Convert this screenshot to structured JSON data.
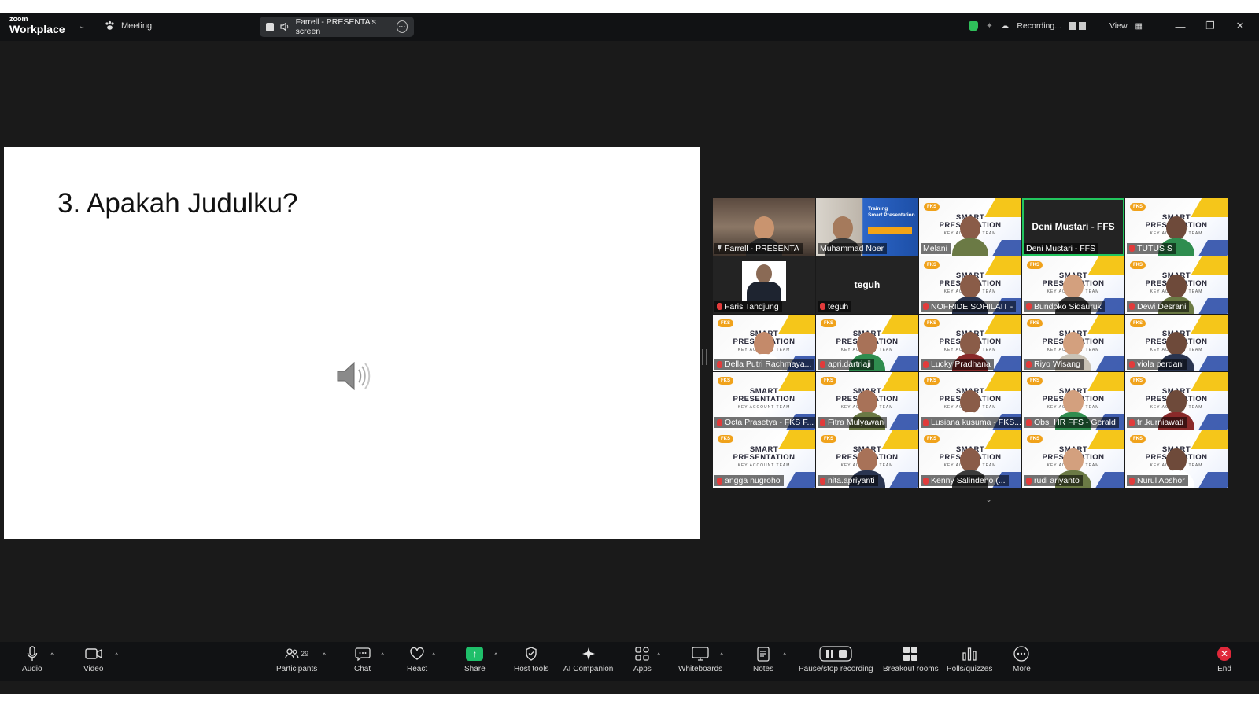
{
  "titlebar": {
    "logo_small": "zoom",
    "logo_big": "Workplace",
    "meeting_label": "Meeting",
    "screen_share_label": "Farrell - PRESENTA's screen",
    "recording_label": "Recording...",
    "view_label": "View"
  },
  "slide": {
    "title": "3. Apakah Judulku?"
  },
  "gallery": {
    "tiles": [
      {
        "name": "Farrell - PRESENTA",
        "style": "photo"
      },
      {
        "name": "Muhammad Noer",
        "style": "training"
      },
      {
        "name": "Melani",
        "style": "bg"
      },
      {
        "name": "Deni Mustari - FFS",
        "style": "dark",
        "big": "Deni Mustari - FFS"
      },
      {
        "name": "TUTUS S",
        "style": "bg"
      },
      {
        "name": "Faris Tandjung",
        "style": "portrait"
      },
      {
        "name": "teguh",
        "style": "dark",
        "big": "teguh"
      },
      {
        "name": "NOFRIDE SOHILAIT -",
        "style": "bg"
      },
      {
        "name": "Bundoko Sidauruk",
        "style": "bg"
      },
      {
        "name": "Dewi Desrani",
        "style": "bg"
      },
      {
        "name": "Della Putri Rachmaya...",
        "style": "bg"
      },
      {
        "name": "apri.dartriaji",
        "style": "bg"
      },
      {
        "name": "Lucky Pradhana",
        "style": "bg"
      },
      {
        "name": "Riyo Wisang",
        "style": "bg"
      },
      {
        "name": "viola perdani",
        "style": "bg"
      },
      {
        "name": "Octa Prasetya - FKS F...",
        "style": "bg"
      },
      {
        "name": "Fitra Mulyawan",
        "style": "bg"
      },
      {
        "name": "Lusiana kusuma - FKS...",
        "style": "bg"
      },
      {
        "name": "Obs_HR FFS - Gerald",
        "style": "bg"
      },
      {
        "name": "tri.kurniawati",
        "style": "bg"
      },
      {
        "name": "angga nugroho",
        "style": "bg"
      },
      {
        "name": "nita.apriyanti",
        "style": "bg"
      },
      {
        "name": "Kenny Salindeho (...",
        "style": "bg"
      },
      {
        "name": "rudi ariyanto",
        "style": "bg"
      },
      {
        "name": "Nurul Abshor",
        "style": "bg"
      }
    ],
    "tile_brand": "FKS",
    "tile_logo_line1": "SMART",
    "tile_logo_line2": "PRESENTATION",
    "tile_logo_sub": "KEY ACCOUNT TEAM",
    "training_line1": "Training",
    "training_line2": "Smart Presentation"
  },
  "toolbar": {
    "audio": "Audio",
    "video": "Video",
    "participants": "Participants",
    "participants_count": "29",
    "chat": "Chat",
    "react": "React",
    "share": "Share",
    "host_tools": "Host tools",
    "ai_companion": "AI Companion",
    "apps": "Apps",
    "whiteboards": "Whiteboards",
    "notes": "Notes",
    "pause_stop": "Pause/stop recording",
    "breakout": "Breakout rooms",
    "polls": "Polls/quizzes",
    "more": "More",
    "end": "End"
  },
  "colors": {
    "background": "#1a1a1a",
    "active_speaker": "#22c55e",
    "share_green": "#1fbf6a",
    "end_red": "#e0283a",
    "fks_yellow": "#f5c61a",
    "fks_blue": "#2d4fa8"
  }
}
